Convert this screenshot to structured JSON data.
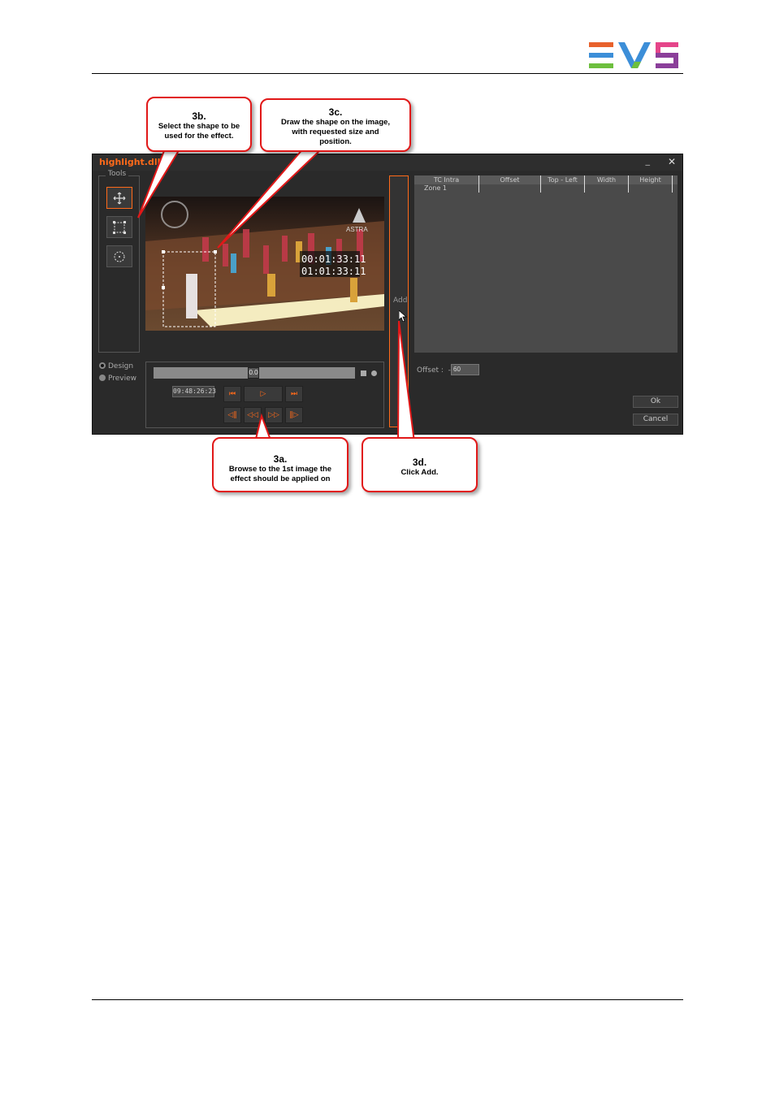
{
  "header": {
    "logo_icon": "evs-logo-icon",
    "logo_colors": [
      "#e8612c",
      "#3c8ed8",
      "#6dbf3e",
      "#8b3f9a",
      "#e5458a"
    ]
  },
  "window": {
    "title": "highlight.dll",
    "minimize_glyph": "_",
    "close_glyph": "✕",
    "accent": "#ff6a1a",
    "tools": {
      "label": "Tools",
      "buttons": [
        {
          "icon": "move-icon",
          "selected": true
        },
        {
          "icon": "rectangle-shape-icon",
          "selected": false
        },
        {
          "icon": "ellipse-shape-icon",
          "selected": false
        }
      ]
    },
    "video": {
      "overlay_tc1": "00:01:33:11",
      "overlay_tc2": "01:01:33:11",
      "watermark": "ASTRA"
    },
    "modes": [
      {
        "label": "Design",
        "selected": true
      },
      {
        "label": "Preview",
        "selected": false
      }
    ],
    "transport": {
      "slider_value": "0.0",
      "timecode": "09:48:26:23",
      "row1": [
        "⏮",
        "▷",
        "⏭"
      ],
      "row2": [
        "◁‖",
        "◁◁",
        "▷▷",
        "‖▷"
      ]
    },
    "add_label": "Add",
    "grid": {
      "columns": [
        "TC Intra",
        "Offset",
        "Top - Left",
        "Width",
        "Height"
      ],
      "rows": [
        [
          "Zone 1",
          "",
          "",
          "",
          ""
        ]
      ]
    },
    "offset": {
      "label": "Offset :",
      "sign": "-",
      "value": "60"
    },
    "ok_label": "Ok",
    "cancel_label": "Cancel"
  },
  "callouts": {
    "c3b": {
      "step": "3b.",
      "text": "Select the shape to be used for the effect."
    },
    "c3c": {
      "step": "3c.",
      "text": "Draw the shape on the image, with requested size and position."
    },
    "c3a": {
      "step": "3a.",
      "text": "Browse to the 1st image the effect should be applied on"
    },
    "c3d": {
      "step": "3d.",
      "text": "Click Add."
    }
  }
}
